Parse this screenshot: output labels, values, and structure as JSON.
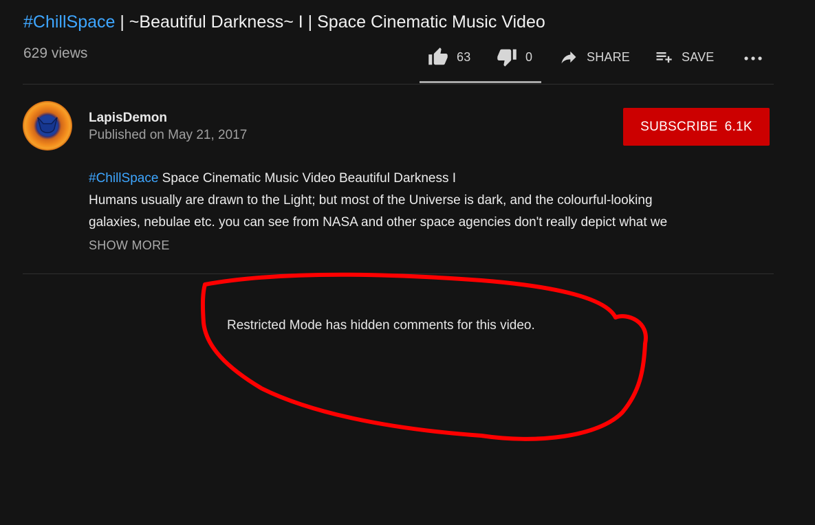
{
  "video": {
    "title_hashtag": "#ChillSpace",
    "title_rest": " | ~Beautiful Darkness~ I | Space Cinematic Music Video",
    "views": "629 views"
  },
  "actions": {
    "like_count": "63",
    "dislike_count": "0",
    "share_label": "SHARE",
    "save_label": "SAVE",
    "like_ratio": 1.0
  },
  "channel": {
    "name": "LapisDemon",
    "published": "Published on May 21, 2017",
    "subscribe_label": "SUBSCRIBE",
    "subscriber_count": "6.1K"
  },
  "description": {
    "hashtag": "#ChillSpace",
    "line1_rest": " Space Cinematic Music Video Beautiful Darkness I",
    "line2": "Humans usually are drawn to the Light; but most of the Universe is dark, and the colourful-looking",
    "line3": "galaxies, nebulae etc. you can see from NASA and other space agencies don't really depict what we",
    "show_more": "SHOW MORE"
  },
  "comments": {
    "restricted_message": "Restricted Mode has hidden comments for this video."
  },
  "colors": {
    "background": "#141414",
    "link": "#3ea6ff",
    "subscribe": "#cc0000",
    "annotation": "#ff0000"
  }
}
